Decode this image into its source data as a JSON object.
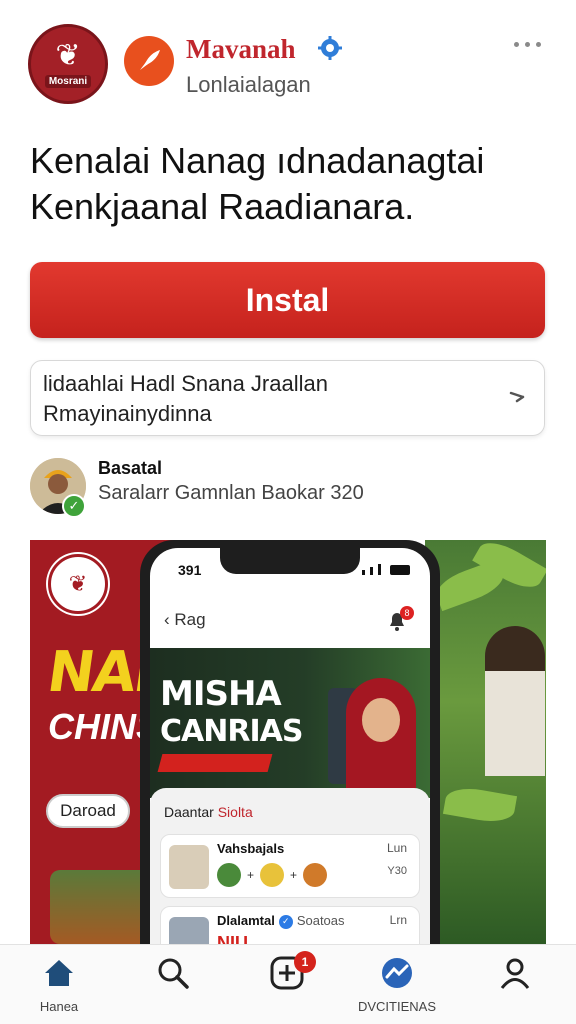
{
  "header": {
    "logo_text": "Mosrani",
    "app_name": "Mavanah",
    "app_category": "Lonlaialagan",
    "icons": {
      "app": "rocket-icon",
      "verified": "gear-badge-icon",
      "more": "more-dots-icon"
    }
  },
  "headline": {
    "line1": "Kenalai Nanag ıdnadanagtai",
    "line2": "Kenkjaanal Raadianara."
  },
  "install": {
    "label": "Instal",
    "color": "#d42a24"
  },
  "info_card": {
    "line1": "lidaahlai Hadl Snana Jraallan",
    "line2": "Rmayinainydinna"
  },
  "developer": {
    "name": "Basatal",
    "meta": "Saralarr Gamnlan Baokar 320"
  },
  "promo": {
    "left_big1": "NAR",
    "left_big2": "CHINS",
    "left_pill": "Daroad",
    "phone": {
      "time": "391",
      "nav_back": "Rag",
      "bell_badge": "8",
      "banner_line1": "MISHA",
      "banner_line2": "CANRIAS",
      "sheet_title_a": "Daantar ",
      "sheet_title_b": "Siolta",
      "rows": [
        {
          "title": "Vahsbajals",
          "meta": "Lun",
          "sub": "Y30"
        },
        {
          "title": "Dlalamtal",
          "badge_text": "Soatoas",
          "meta": "Lrn",
          "nu": "NIU"
        }
      ]
    }
  },
  "tabbar": {
    "tabs": [
      {
        "label": "Hanea",
        "icon": "home-icon"
      },
      {
        "label": "",
        "icon": "search-icon"
      },
      {
        "label": "",
        "icon": "add-icon",
        "badge": "1"
      },
      {
        "label": "DVCITIENAS",
        "icon": "activity-icon"
      },
      {
        "label": "",
        "icon": "profile-icon"
      }
    ]
  }
}
